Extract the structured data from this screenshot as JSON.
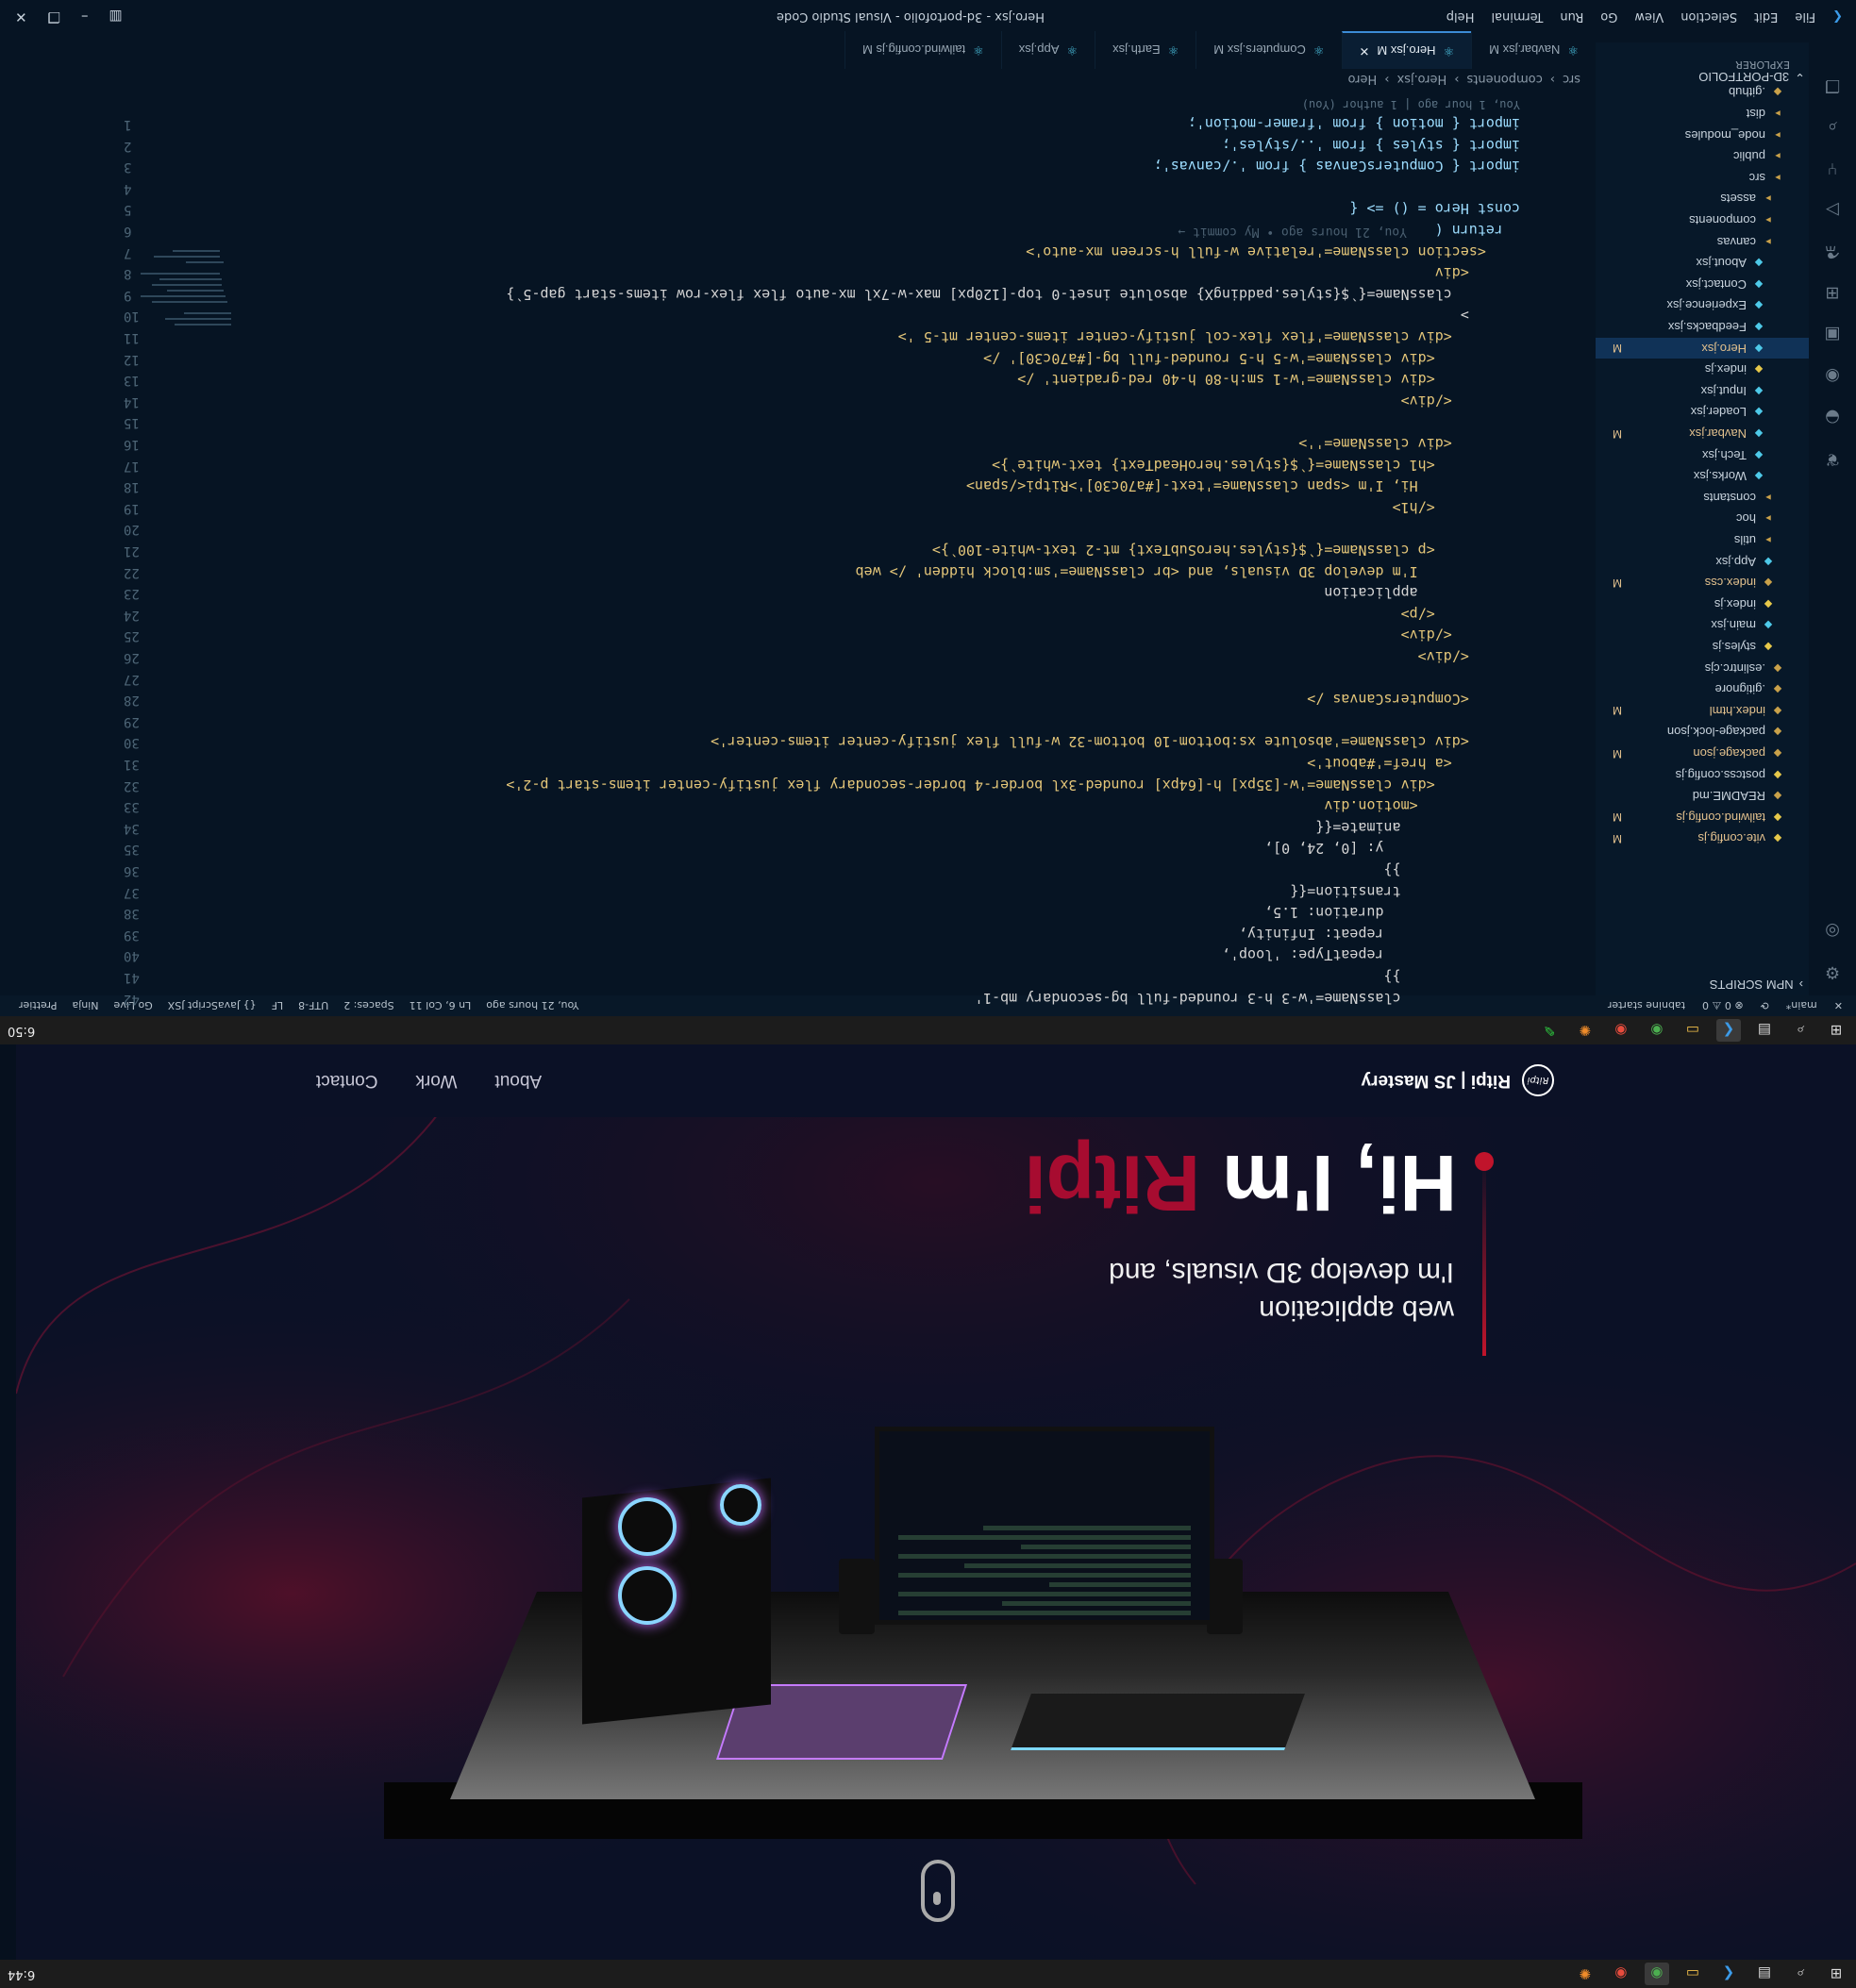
{
  "browser_taskbar": {
    "time": "6:44",
    "icons": [
      "windows-icon",
      "search-icon",
      "files-icon",
      "vscode-icon",
      "explorer-icon",
      "chrome-icon",
      "chrome-alt-icon",
      "blender-icon"
    ]
  },
  "hero": {
    "greeting": "Hi, I'm ",
    "name": "Ritpi",
    "subtitle_line1": "I'm develop 3D visuals, and",
    "subtitle_line2": "web application",
    "logo_mark": "Ritpi",
    "logo_text": "Ritpi | JS Mastery",
    "nav": [
      "About",
      "Work",
      "Contact"
    ]
  },
  "vscode_taskbar": {
    "time": "6:50"
  },
  "statusbar": {
    "left": [
      "main*",
      "⊗ 0 ⚠ 0",
      "tabnine starter"
    ],
    "right": [
      "You, 21 hours ago",
      "Ln 6, Col 11",
      "Spaces: 2",
      "UTF-8",
      "LF",
      "{} JavaScript JSX",
      "Go Live",
      "Ninja",
      "Prettier"
    ]
  },
  "explorer": {
    "header": "EXPLORER",
    "root": "3D-PORTFOLIO",
    "npm_scripts": "NPM SCRIPTS",
    "items": [
      {
        "label": "vite.config.js",
        "badge": "M"
      },
      {
        "label": "tailwind.config.js",
        "badge": "M"
      },
      {
        "label": "README.md",
        "badge": ""
      },
      {
        "label": "postcss.config.js",
        "badge": ""
      },
      {
        "label": "package.json",
        "badge": "M"
      },
      {
        "label": "package-lock.json",
        "badge": ""
      },
      {
        "label": "index.html",
        "badge": "M"
      },
      {
        "label": ".gitignore",
        "badge": ""
      },
      {
        "label": ".eslintrc.cjs",
        "badge": ""
      },
      {
        "label": "styles.js",
        "badge": ""
      },
      {
        "label": "main.jsx",
        "badge": ""
      },
      {
        "label": "index.js",
        "badge": ""
      },
      {
        "label": "index.css",
        "badge": "M"
      },
      {
        "label": "App.jsx",
        "badge": ""
      },
      {
        "label": "utils",
        "badge": ""
      },
      {
        "label": "hoc",
        "badge": ""
      },
      {
        "label": "constants",
        "badge": ""
      },
      {
        "label": "Works.jsx",
        "badge": ""
      },
      {
        "label": "Tech.jsx",
        "badge": ""
      },
      {
        "label": "Navbar.jsx",
        "badge": "M"
      },
      {
        "label": "Loader.jsx",
        "badge": ""
      },
      {
        "label": "Input.jsx",
        "badge": ""
      },
      {
        "label": "index.js",
        "badge": ""
      },
      {
        "label": "Hero.jsx",
        "badge": "M"
      },
      {
        "label": "Feedbacks.jsx",
        "badge": ""
      },
      {
        "label": "Experience.jsx",
        "badge": ""
      },
      {
        "label": "Contact.jsx",
        "badge": ""
      },
      {
        "label": "About.jsx",
        "badge": ""
      },
      {
        "label": "canvas",
        "badge": ""
      },
      {
        "label": "components",
        "badge": ""
      },
      {
        "label": "assets",
        "badge": ""
      },
      {
        "label": "src",
        "badge": ""
      },
      {
        "label": "public",
        "badge": ""
      },
      {
        "label": "node_modules",
        "badge": ""
      },
      {
        "label": "dist",
        "badge": ""
      },
      {
        "label": ".github",
        "badge": ""
      }
    ]
  },
  "editor": {
    "blame": "You, 1 hour ago | 1 author (You)",
    "inline_blame": "You, 21 hours ago • My commit →",
    "lines": [
      {
        "n": "1",
        "t": "import { motion } from 'framer-motion';"
      },
      {
        "n": "2",
        "t": "import { styles } from '../styles';"
      },
      {
        "n": "3",
        "t": "import { ComputersCanvas } from './canvas';"
      },
      {
        "n": "4",
        "t": ""
      },
      {
        "n": "5",
        "t": "const Hero = () => {"
      },
      {
        "n": "6",
        "t": "  return ("
      },
      {
        "n": "7",
        "t": "    <section className='relative w-full h-screen mx-auto'>"
      },
      {
        "n": "8",
        "t": "      <div"
      },
      {
        "n": "9",
        "t": "        className={`${styles.paddingX} absolute inset-0 top-[120px] max-w-7xl mx-auto flex flex-row items-start gap-5`}"
      },
      {
        "n": "10",
        "t": "      >"
      },
      {
        "n": "11",
        "t": "        <div className='flex flex-col justify-center items-center mt-5 '>"
      },
      {
        "n": "12",
        "t": "          <div className='w-5 h-5 rounded-full bg-[#a70c30]' />"
      },
      {
        "n": "13",
        "t": "          <div className='w-1 sm:h-80 h-40 red-gradient' />"
      },
      {
        "n": "14",
        "t": "        </div>"
      },
      {
        "n": "15",
        "t": ""
      },
      {
        "n": "16",
        "t": "        <div className=''>"
      },
      {
        "n": "17",
        "t": "          <h1 className={`${styles.heroHeadText} text-white`}>"
      },
      {
        "n": "18",
        "t": "            Hi, I'm <span className='text-[#a70c30]'>Ritpi</span>"
      },
      {
        "n": "19",
        "t": "          </h1>"
      },
      {
        "n": "20",
        "t": ""
      },
      {
        "n": "21",
        "t": "          <p className={`${styles.heroSubText} mt-2 text-white-100`}>"
      },
      {
        "n": "22",
        "t": "            I'm develop 3D visuals, and <br className='sm:block hidden' /> web"
      },
      {
        "n": "23",
        "t": "            application"
      },
      {
        "n": "24",
        "t": "          </p>"
      },
      {
        "n": "25",
        "t": "        </div>"
      },
      {
        "n": "26",
        "t": "      </div>"
      },
      {
        "n": "27",
        "t": ""
      },
      {
        "n": "28",
        "t": "      <ComputersCanvas />"
      },
      {
        "n": "29",
        "t": ""
      },
      {
        "n": "30",
        "t": "      <div className='absolute xs:bottom-10 bottom-32 w-full flex justify-center items-center'>"
      },
      {
        "n": "31",
        "t": "        <a href='#about'>"
      },
      {
        "n": "32",
        "t": "          <div className='w-[35px] h-[64px] rounded-3xl border-4 border-secondary flex justify-center items-start p-2'>"
      },
      {
        "n": "33",
        "t": "            <motion.div"
      },
      {
        "n": "34",
        "t": "              animate={{"
      },
      {
        "n": "35",
        "t": "                y: [0, 24, 0],"
      },
      {
        "n": "36",
        "t": "              }}"
      },
      {
        "n": "37",
        "t": "              transition={{"
      },
      {
        "n": "38",
        "t": "                duration: 1.5,"
      },
      {
        "n": "39",
        "t": "                repeat: Infinity,"
      },
      {
        "n": "40",
        "t": "                repeatType: 'loop',"
      },
      {
        "n": "41",
        "t": "              }}"
      },
      {
        "n": "42",
        "t": "              className='w-3 h-3 rounded-full bg-secondary mb-1'"
      }
    ]
  },
  "breadcrumb": [
    "src",
    "components",
    "Hero.jsx",
    "Hero"
  ],
  "tabs": [
    {
      "label": "Navbar.jsx M",
      "active": false
    },
    {
      "label": "Hero.jsx M",
      "active": true
    },
    {
      "label": "Computers.jsx M",
      "active": false
    },
    {
      "label": "Earth.jsx",
      "active": false
    },
    {
      "label": "App.jsx",
      "active": false
    },
    {
      "label": "tailwind.config.js M",
      "active": false
    }
  ],
  "menu": [
    "File",
    "Edit",
    "Selection",
    "View",
    "Go",
    "Run",
    "Terminal",
    "Help"
  ],
  "window_title": "Hero.jsx - 3d-portofolio - Visual Studio Code",
  "colors": {
    "accent": "#a70c30",
    "hero_bg": "#0b1126",
    "editor_bg": "#061423"
  }
}
